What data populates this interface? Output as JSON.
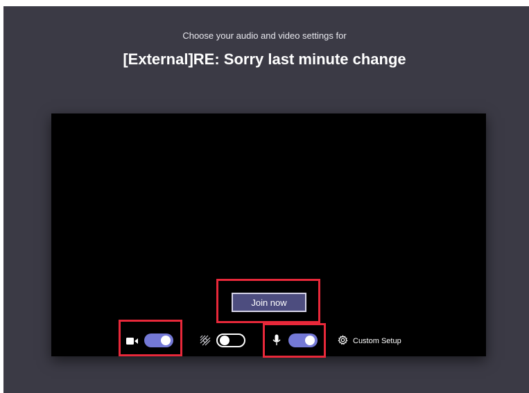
{
  "header": {
    "subtitle": "Choose your audio and video settings for",
    "meeting_title": "[External]RE: Sorry last minute change"
  },
  "preview": {
    "join_label": "Join now"
  },
  "controls": {
    "camera": {
      "icon": "camera-icon",
      "enabled": true
    },
    "background_blur": {
      "icon": "background-blur-icon",
      "enabled": false
    },
    "microphone": {
      "icon": "microphone-icon",
      "enabled": true
    },
    "custom_setup": {
      "icon": "gear-icon",
      "label": "Custom Setup"
    }
  },
  "colors": {
    "background": "#3b3a45",
    "toggle_on": "#7479d6",
    "join_button": "#4d4d7f",
    "highlight": "#e8283a"
  }
}
